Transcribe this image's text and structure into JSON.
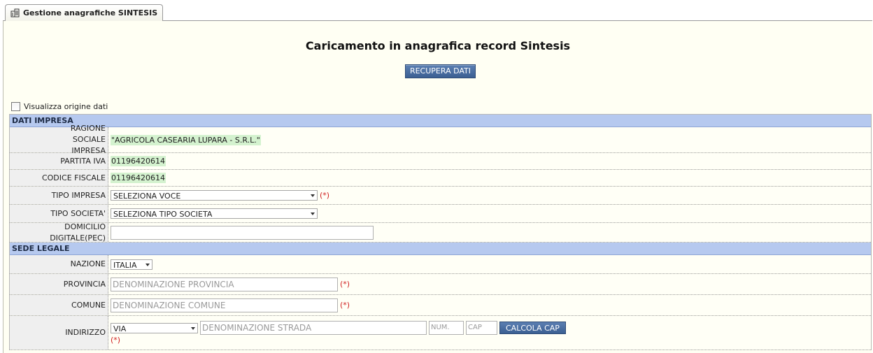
{
  "tab": {
    "label": "Gestione anagrafiche SINTESIS",
    "icon": "building-icon"
  },
  "page_title": "Caricamento in anagrafica record Sintesis",
  "recupera_button": "RECUPERA DATI",
  "origine_checkbox": {
    "label": "Visualizza origine dati",
    "checked": false
  },
  "dati_impresa": {
    "header": "DATI IMPRESA",
    "ragione_sociale_label": "RAGIONE SOCIALE IMPRESA",
    "ragione_sociale_value": "\"AGRICOLA CASEARIA LUPARA - S.R.L.\"",
    "partita_iva_label": "PARTITA IVA",
    "partita_iva_value": "01196420614",
    "codice_fiscale_label": "CODICE FISCALE",
    "codice_fiscale_value": "01196420614",
    "tipo_impresa_label": "TIPO IMPRESA",
    "tipo_impresa_value": "SELEZIONA VOCE",
    "tipo_societa_label": "TIPO SOCIETA'",
    "tipo_societa_value": "SELEZIONA TIPO SOCIETA",
    "pec_label": "DOMICILIO DIGITALE(PEC)",
    "pec_value": ""
  },
  "sede_legale": {
    "header": "SEDE LEGALE",
    "nazione_label": "NAZIONE",
    "nazione_value": "ITALIA",
    "provincia_label": "PROVINCIA",
    "provincia_placeholder": "DENOMINAZIONE PROVINCIA",
    "comune_label": "COMUNE",
    "comune_placeholder": "DENOMINAZIONE COMUNE",
    "indirizzo_label": "INDIRIZZO",
    "via_value": "VIA",
    "strada_placeholder": "DENOMINAZIONE STRADA",
    "num_placeholder": "NUM.",
    "cap_placeholder": "CAP",
    "calcola_cap_button": "CALCOLA CAP"
  },
  "required_marker": "(*)",
  "colors": {
    "section_header": "#b6c9ef",
    "highlight": "#d4f2cf",
    "button": "#3b5f92",
    "required": "#d02020"
  }
}
